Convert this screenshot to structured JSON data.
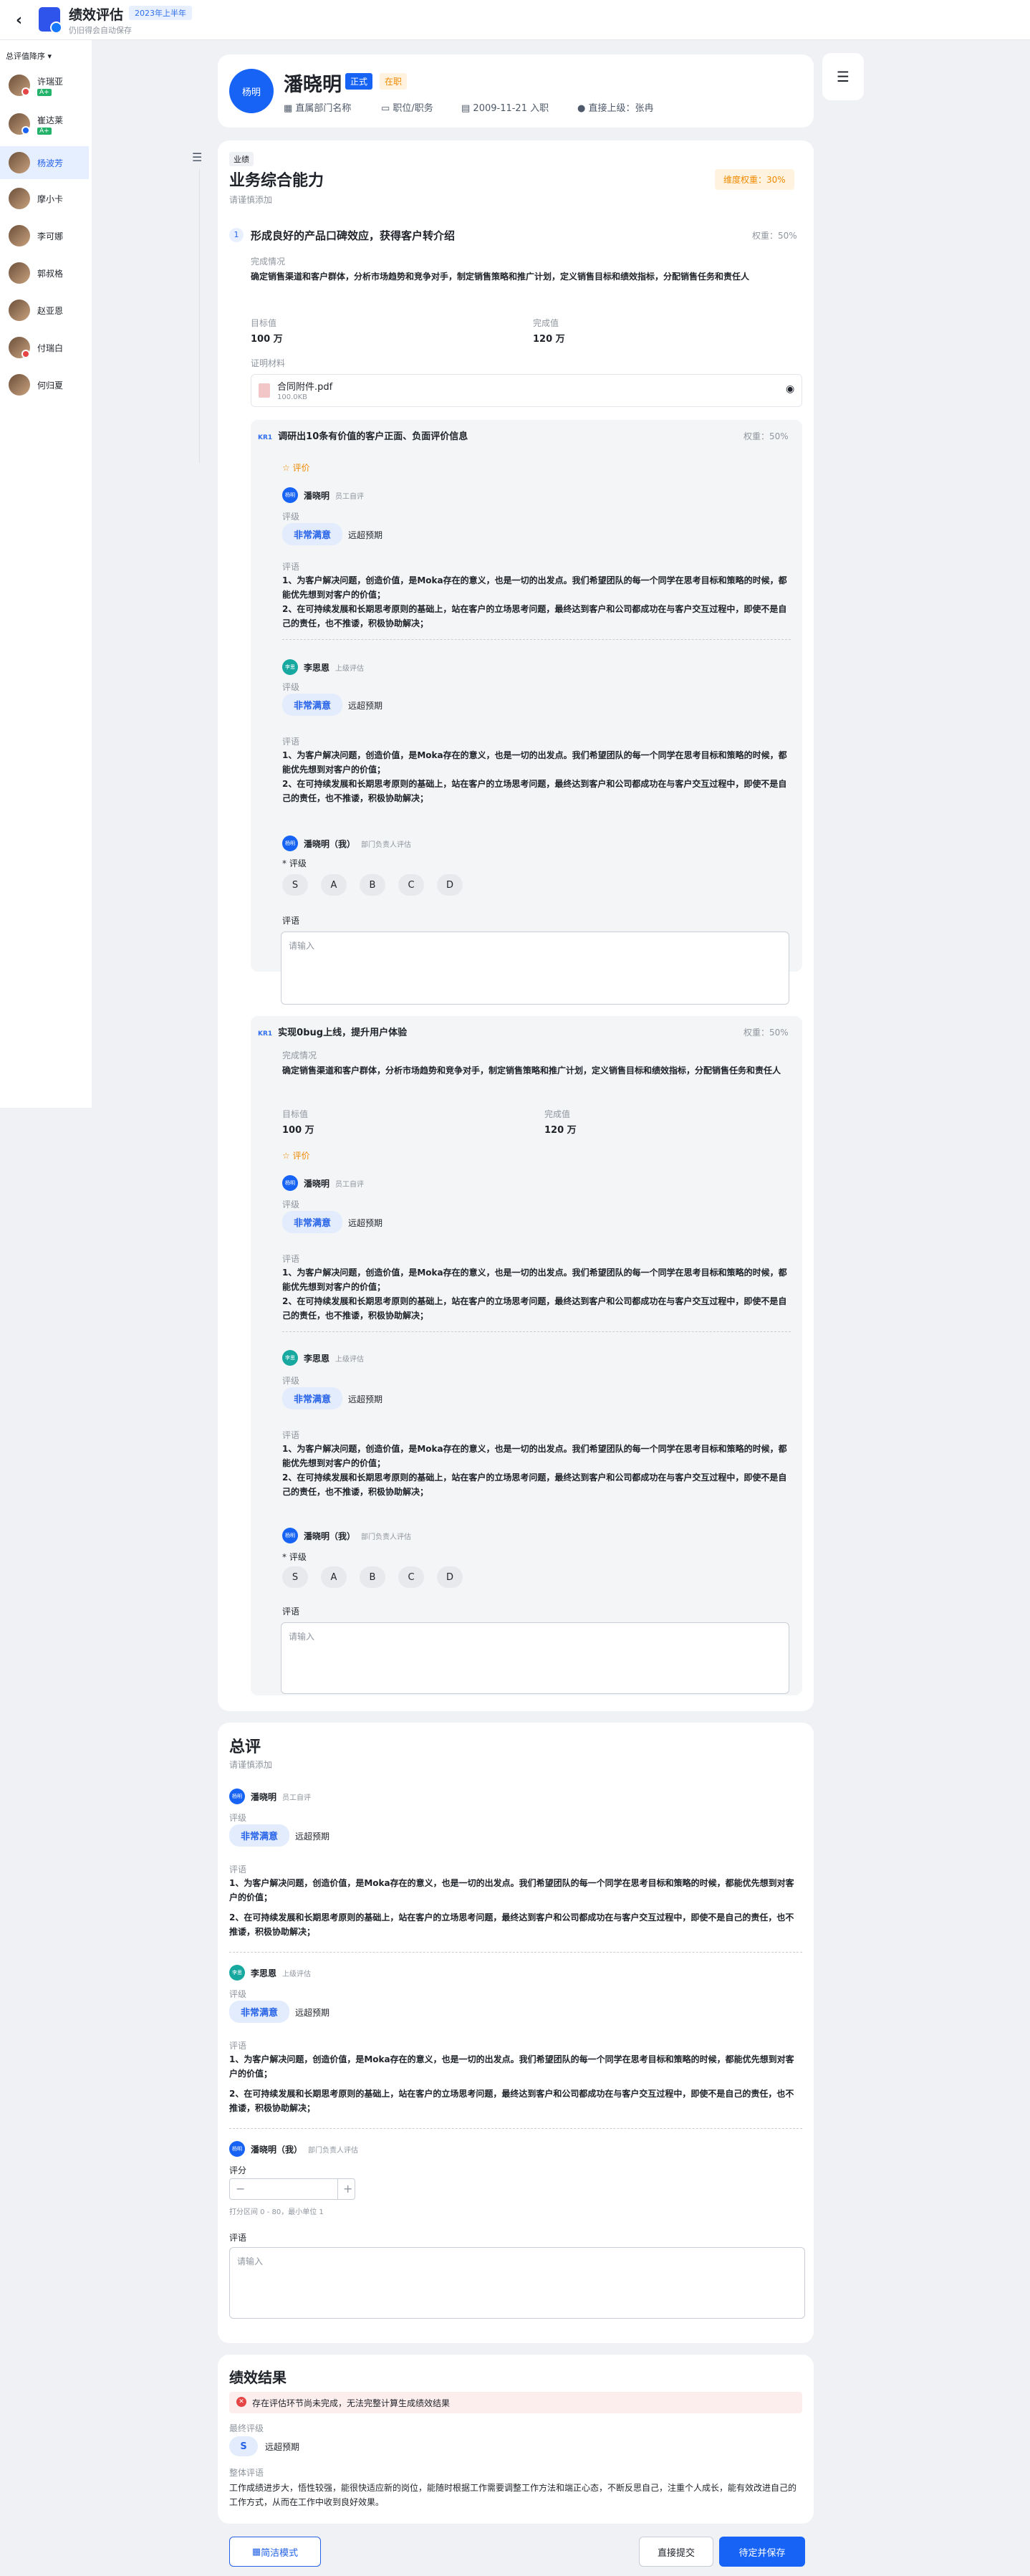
{
  "header": {
    "title": "绩效评估",
    "cycle": "2023年上半年",
    "subtitle": "仍旧得会自动保存"
  },
  "sidebar": {
    "sort_label": "总评值降序",
    "items": [
      {
        "name": "许瑞亚",
        "tag": "A+"
      },
      {
        "name": "崔达莱",
        "tag": "A+"
      },
      {
        "name": "杨波芳"
      },
      {
        "name": "摩小卡"
      },
      {
        "name": "李可娜"
      },
      {
        "name": "郭叔格"
      },
      {
        "name": "赵亚恩"
      },
      {
        "name": "付瑞白"
      },
      {
        "name": "何归夏"
      }
    ]
  },
  "employee": {
    "avatar": "杨明",
    "name": "潘晓明",
    "status": "正式",
    "employment": "在职",
    "dept": "直属部门名称",
    "role": "职位/职务",
    "joined": "2009-11-21 入职",
    "manager": "直接上级：张冉"
  },
  "section": {
    "tag": "业绩",
    "title": "业务综合能力",
    "hint": "请谨慎添加",
    "weight": "维度权重：30%"
  },
  "goal": {
    "index": "1",
    "title": "形成良好的产品口碑效应，获得客户转介绍",
    "weight": "权重：50%",
    "done_label": "完成情况",
    "done_text": "确定销售渠道和客户群体，分析市场趋势和竞争对手，制定销售策略和推广计划，定义销售目标和绩效指标，分配销售任务和责任人",
    "target_label": "目标值",
    "target": "100 万",
    "actual_label": "完成值",
    "actual": "120 万",
    "proof_label": "证明材料",
    "file_name": "合同附件.pdf",
    "file_size": "100.0KB"
  },
  "kr1": {
    "badge": "KR1",
    "title": "调研出10条有价值的客户正面、负面评价信息",
    "weight": "权重：50%"
  },
  "kr2": {
    "badge": "KR1",
    "title": "实现0bug上线，提升用户体验",
    "weight": "权重：50%",
    "done_label": "完成情况",
    "done_text": "确定销售渠道和客户群体，分析市场趋势和竞争对手，制定销售策略和推广计划，定义销售目标和绩效指标，分配销售任务和责任人",
    "target_label": "目标值",
    "target": "100 万",
    "actual_label": "完成值",
    "actual": "120 万"
  },
  "eval": {
    "header": "评价",
    "level_label": "评级",
    "comment_label": "评语",
    "grade": "非常满意",
    "grade_note": "远超预期",
    "comment1": "1、为客户解决问题，创造价值，是Moka存在的意义，也是一切的出发点。我们希望团队的每一个同学在思考目标和策略的时候，都能优先想到对客户的价值；",
    "comment2": "2、在可持续发展和长期思考原则的基础上，站在客户的立场思考问题，最终达到客户和公司都成功在与客户交互过程中，即使不是自己的责任，也不推诿，积极协助解决；",
    "self_name": "潘晓明",
    "self_role": "员工自评",
    "sup_name": "李思恩",
    "sup_role": "上级评估",
    "me_name": "潘晓明（我）",
    "me_role": "部门负责人评估",
    "req_level": "* 评级",
    "grades": [
      "S",
      "A",
      "B",
      "C",
      "D"
    ],
    "placeholder": "请输入",
    "score_label": "评分",
    "score_hint": "打分区间 0 - 80，最小单位 1",
    "minus": "−",
    "plus": "+"
  },
  "summary": {
    "title": "总评",
    "hint": "请谨慎添加"
  },
  "result": {
    "title": "绩效结果",
    "warn": "存在评估环节尚未完成，无法完整计算生成绩效结果",
    "final_label": "最终评级",
    "final": "S",
    "final_note": "远超预期",
    "overall_label": "整体评语",
    "overall": "工作成绩进步大，悟性较强，能很快适应新的岗位，能随时根据工作需要调整工作方法和端正心态，不断反思自己，注重个人成长，能有效改进自己的工作方式，从而在工作中收到良好效果。"
  },
  "footer": {
    "simple": "简洁模式",
    "submit": "直接提交",
    "save": "待定并保存"
  }
}
